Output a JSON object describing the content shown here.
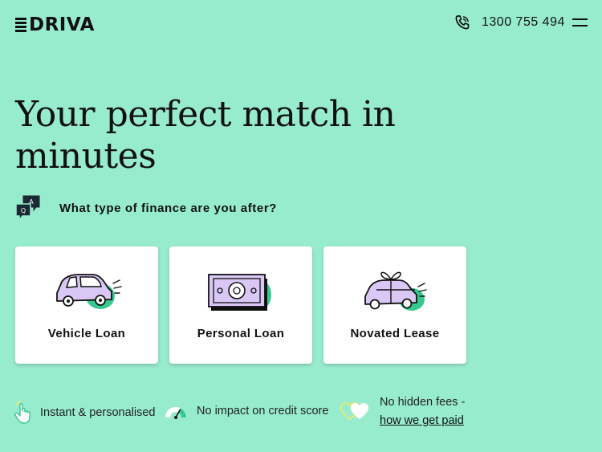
{
  "header": {
    "logo_text": "DRIVA",
    "phone": "1300 755 494"
  },
  "hero": {
    "headline_line1": "Your perfect match in",
    "headline_line2": "minutes"
  },
  "question": {
    "text": "What type of finance are you after?",
    "icon_letters": {
      "a": "A",
      "q": "Q"
    }
  },
  "cards": [
    {
      "label": "Vehicle Loan"
    },
    {
      "label": "Personal Loan"
    },
    {
      "label": "Novated Lease"
    }
  ],
  "features": {
    "instant": "Instant & personalised",
    "credit": "No impact on credit score",
    "fees": "No hidden fees -",
    "fees_link": "how we get paid"
  },
  "colors": {
    "background": "#98ecce",
    "accent_green": "#35c98f",
    "accent_lilac": "#d9c7f5",
    "ink": "#111111"
  }
}
